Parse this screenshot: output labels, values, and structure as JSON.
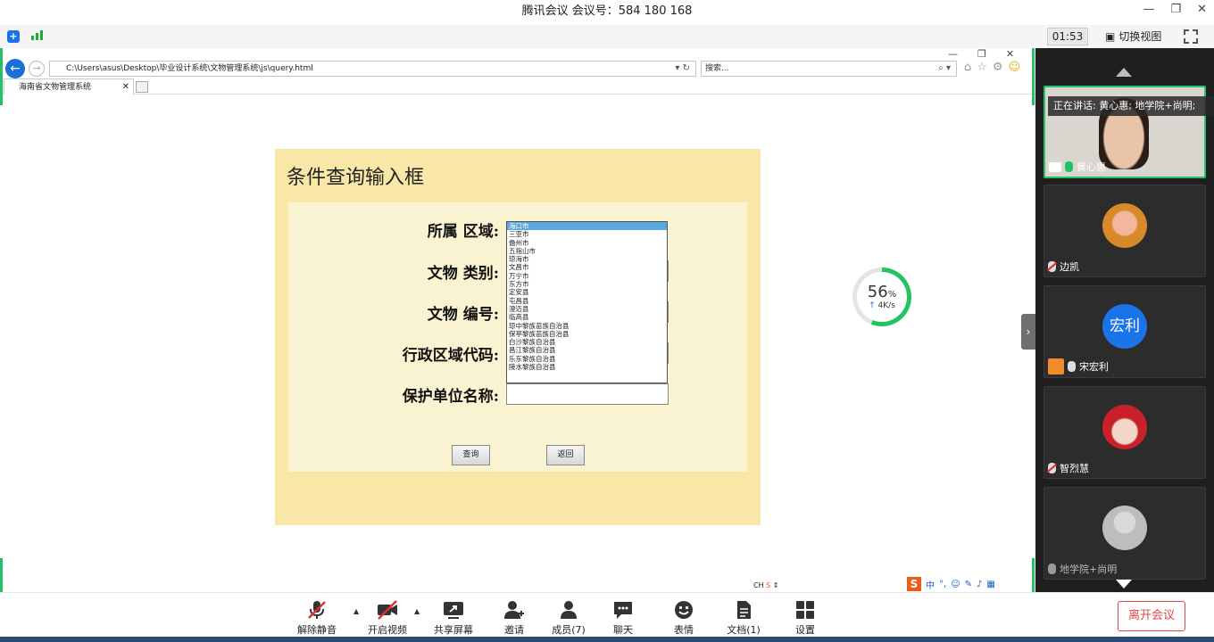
{
  "window": {
    "title": "腾讯会议 会议号：584 180 168"
  },
  "meetbar": {
    "timer": "01:53",
    "switch_view": "切换视图"
  },
  "browser": {
    "address": "C:\\Users\\asus\\Desktop\\毕业设计系统\\文物管理系统\\js\\query.html",
    "search_placeholder": "搜索...",
    "tab_title": "海南省文物管理系统"
  },
  "form": {
    "title": "条件查询输入框",
    "labels": {
      "region": "所属 区域:",
      "category": "文物 类别:",
      "number": "文物 编号:",
      "code": "行政区域代码:",
      "unit": "保护单位名称:"
    },
    "region_options": [
      "海口市",
      "三亚市",
      "儋州市",
      "五指山市",
      "琼海市",
      "文昌市",
      "万宁市",
      "东方市",
      "定安县",
      "屯昌县",
      "澄迈县",
      "临高县",
      "琼中黎族苗族自治县",
      "保亭黎族苗族自治县",
      "白沙黎族自治县",
      "昌江黎族自治县",
      "乐东黎族自治县",
      "陵水黎族自治县"
    ],
    "selected_index": 0,
    "query_button": "查询",
    "back_button": "返回"
  },
  "speed": {
    "percent": "56",
    "percent_unit": "%",
    "rate": "4K/s",
    "progress_fraction": 0.56
  },
  "status": {
    "ch": "CH",
    "ime": "中"
  },
  "sidebar": {
    "speaking": "正在讲话: 黄心惠; 地学院+尚明;",
    "participants": [
      {
        "name": "黄心惠"
      },
      {
        "name": "边凯"
      },
      {
        "name": "宋宏利",
        "avatar_text": "宏利"
      },
      {
        "name": "智烈慧"
      },
      {
        "name": "地学院+尚明"
      }
    ]
  },
  "controls": {
    "unmute": "解除静音",
    "video": "开启视频",
    "share": "共享屏幕",
    "invite": "邀请",
    "members": "成员(7)",
    "chat": "聊天",
    "emoji": "表情",
    "docs": "文档(1)",
    "settings": "设置",
    "leave": "离开会议"
  },
  "colors": {
    "panel": "#f8e7a7",
    "panel_inner": "#faf3d1",
    "accent_green": "#23c26a",
    "leave_red": "#e04848",
    "sidebar_bg": "#1f1f1f"
  }
}
